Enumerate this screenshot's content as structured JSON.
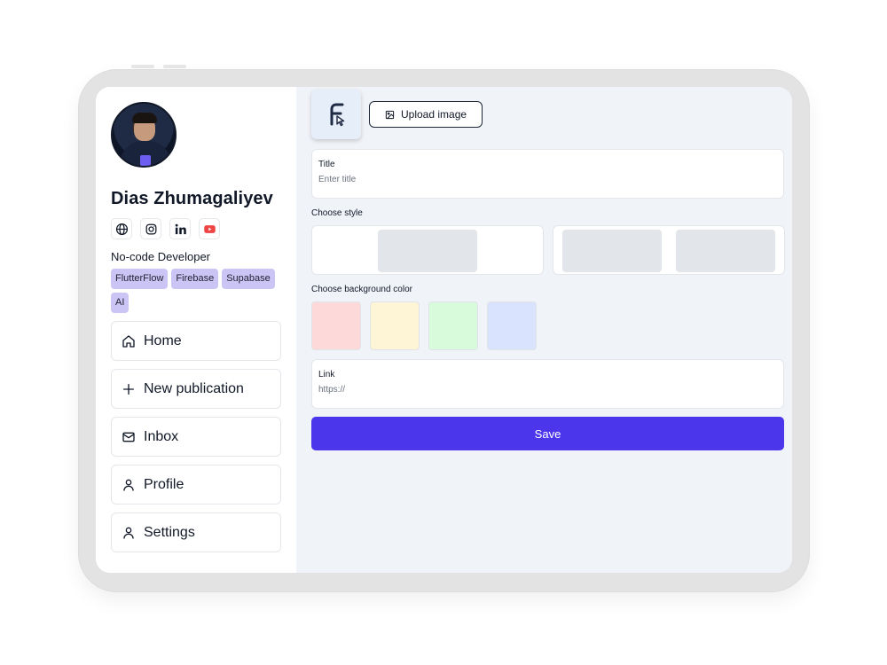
{
  "profile": {
    "name": "Dias Zhumagaliyev",
    "role": "No-code Developer",
    "tags": [
      "FlutterFlow",
      "Firebase",
      "Supabase",
      "AI"
    ],
    "socials": [
      "globe-icon",
      "instagram-icon",
      "linkedin-icon",
      "youtube-icon"
    ]
  },
  "nav": {
    "items": [
      {
        "label": "Home",
        "icon": "home-icon"
      },
      {
        "label": "New publication",
        "icon": "plus-icon"
      },
      {
        "label": "Inbox",
        "icon": "mail-icon"
      },
      {
        "label": "Profile",
        "icon": "user-icon"
      },
      {
        "label": "Settings",
        "icon": "user-icon"
      }
    ]
  },
  "main": {
    "upload_label": "Upload image",
    "title_label": "Title",
    "title_placeholder": "Enter title",
    "style_label": "Choose style",
    "bg_label": "Choose background color",
    "bg_colors": [
      "#fdd9d9",
      "#fdf5d5",
      "#d8fbdc",
      "#d9e3fd"
    ],
    "link_label": "Link",
    "link_placeholder": "https://",
    "save_label": "Save"
  },
  "colors": {
    "accent": "#4b36ec",
    "tag_bg": "#cbc5f6",
    "youtube": "#ef4444"
  }
}
